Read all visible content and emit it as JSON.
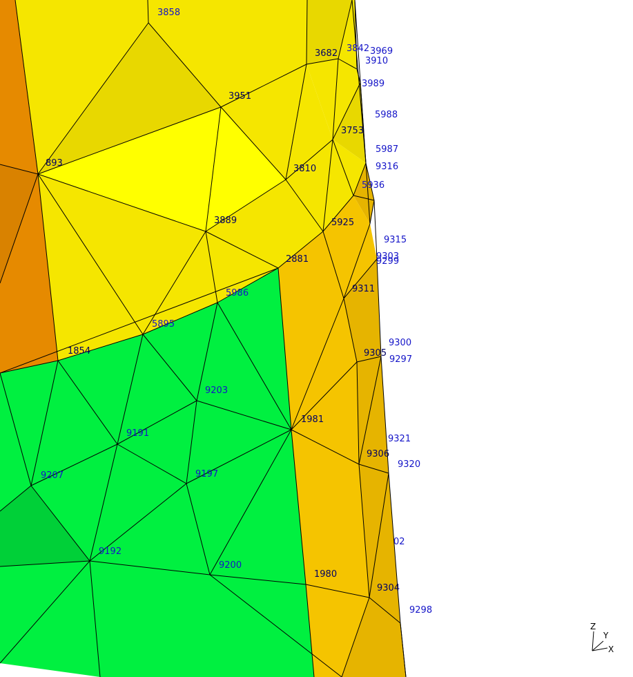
{
  "colors": {
    "background": "#ffffff",
    "edge": "#000000",
    "label_blue": "#1414c8",
    "label_dark": "#000064",
    "orange": "#e68a00",
    "orange_dark": "#d98200",
    "amber": "#f5c400",
    "amber_dark": "#e6b400",
    "yellow": "#f5e600",
    "yellow_bright": "#ffff00",
    "yellow_dark": "#e8d800",
    "green": "#00f040",
    "green_dark": "#00d038"
  },
  "node_labels": [
    {
      "text": "3858",
      "color": "blue"
    },
    {
      "text": "3682",
      "color": "dark"
    },
    {
      "text": "3842",
      "color": "blue"
    },
    {
      "text": "3969",
      "color": "blue"
    },
    {
      "text": "3910",
      "color": "blue"
    },
    {
      "text": "3989",
      "color": "blue"
    },
    {
      "text": "3951",
      "color": "dark"
    },
    {
      "text": "5988",
      "color": "blue"
    },
    {
      "text": "3753",
      "color": "dark"
    },
    {
      "text": "5987",
      "color": "blue"
    },
    {
      "text": "893",
      "color": "dark"
    },
    {
      "text": "3810",
      "color": "dark"
    },
    {
      "text": "9316",
      "color": "blue"
    },
    {
      "text": "5936",
      "color": "blue"
    },
    {
      "text": "3889",
      "color": "dark"
    },
    {
      "text": "5925",
      "color": "dark"
    },
    {
      "text": "9315",
      "color": "blue"
    },
    {
      "text": "2881",
      "color": "dark"
    },
    {
      "text": "9303",
      "color": "blue"
    },
    {
      "text": "9299",
      "color": "blue"
    },
    {
      "text": "9311",
      "color": "dark"
    },
    {
      "text": "5986",
      "color": "blue"
    },
    {
      "text": "5895",
      "color": "blue"
    },
    {
      "text": "9300",
      "color": "blue"
    },
    {
      "text": "1854",
      "color": "dark"
    },
    {
      "text": "9305",
      "color": "dark"
    },
    {
      "text": "9297",
      "color": "blue"
    },
    {
      "text": "9203",
      "color": "blue"
    },
    {
      "text": "1981",
      "color": "dark"
    },
    {
      "text": "9191",
      "color": "blue"
    },
    {
      "text": "9321",
      "color": "blue"
    },
    {
      "text": "9306",
      "color": "dark"
    },
    {
      "text": "9207",
      "color": "blue"
    },
    {
      "text": "9197",
      "color": "blue"
    },
    {
      "text": "9320",
      "color": "blue"
    },
    {
      "text": "02",
      "color": "blue"
    },
    {
      "text": "9192",
      "color": "blue"
    },
    {
      "text": "9200",
      "color": "blue"
    },
    {
      "text": "1980",
      "color": "dark"
    },
    {
      "text": "9304",
      "color": "dark"
    },
    {
      "text": "9298",
      "color": "blue"
    }
  ],
  "axis_triad": {
    "z": "Z",
    "y": "Y",
    "x": "X"
  }
}
